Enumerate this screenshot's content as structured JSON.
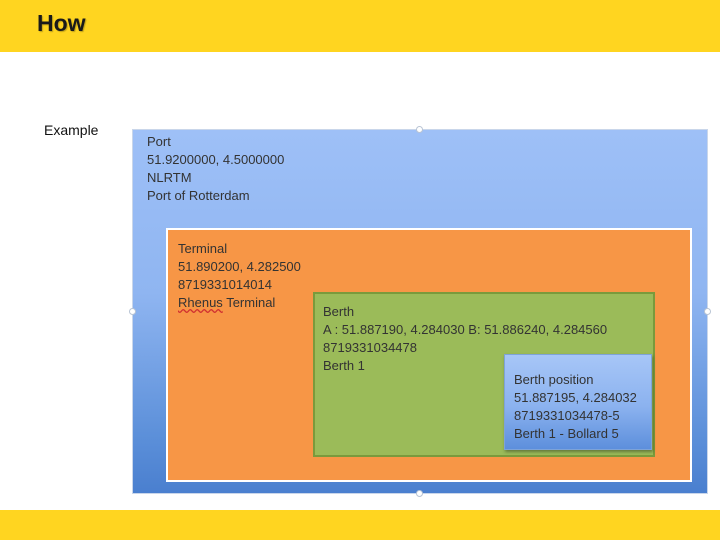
{
  "slide": {
    "title": "How",
    "side_label": "Example"
  },
  "diagram": {
    "port": {
      "type": "Port",
      "coords": "51.9200000, 4.5000000",
      "code": "NLRTM",
      "name": "Port of Rotterdam"
    },
    "terminal": {
      "type": "Terminal",
      "coords": "51.890200, 4.282500",
      "code": "8719331014014",
      "name_first": "Rhenus",
      "name_rest": " Terminal"
    },
    "berth": {
      "type": "Berth",
      "coords": "A : 51.887190, 4.284030 B: 51.886240, 4.284560",
      "code": "8719331034478",
      "name": "Berth 1"
    },
    "berth_position": {
      "type": "Berth position",
      "coords": "51.887195, 4.284032",
      "code": "8719331034478-5",
      "name": "Berth 1 - Bollard 5"
    }
  },
  "colors": {
    "bar_yellow": "#ffd520",
    "port_blue": "#8fb5f1",
    "terminal_orange": "#f79646",
    "berth_green": "#9bbb59",
    "berth_position_blue": "#8bb2ef"
  }
}
